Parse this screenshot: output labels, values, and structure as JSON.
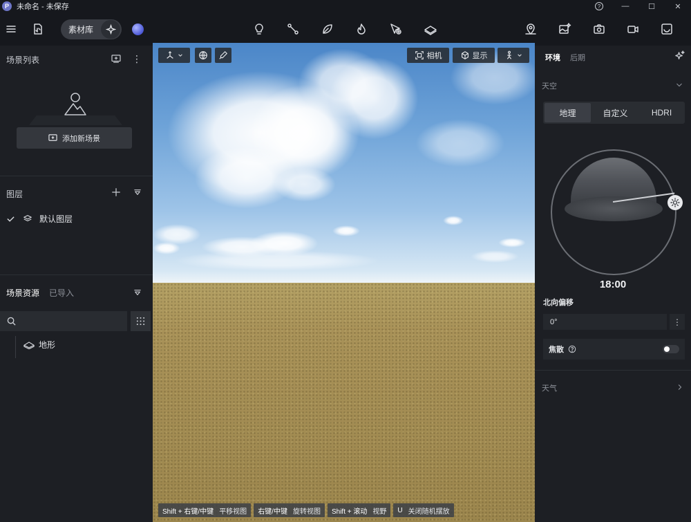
{
  "window": {
    "title": "未命名 - 未保存",
    "logo_letter": "P",
    "help": "?",
    "minimize": "—",
    "maximize": "☐",
    "close": "✕"
  },
  "toolbar": {
    "library_label": "素材库"
  },
  "left_panel": {
    "scene_list_title": "场景列表",
    "add_scene_label": "添加新场景",
    "layers_title": "图层",
    "default_layer": "默认图层",
    "resources_tab": "场景资源",
    "imported_tab": "已导入",
    "search_placeholder": "",
    "terrain_label": "地形"
  },
  "viewport": {
    "camera_label": "相机",
    "display_label": "显示",
    "hints": [
      {
        "key": "Shift + 右键/中键",
        "action": "平移视图"
      },
      {
        "key": "右键/中键",
        "action": "旋转视图"
      },
      {
        "key": "Shift + 滚动",
        "action": "视野"
      },
      {
        "key": "U",
        "action": "关闭随机摆放"
      }
    ]
  },
  "right_panel": {
    "tab_environment": "环境",
    "tab_post": "后期",
    "sky_header": "天空",
    "sky_modes": [
      "地理",
      "自定义",
      "HDRI"
    ],
    "active_sky_mode": "地理",
    "time": "18:00",
    "north_offset_label": "北向偏移",
    "north_offset_value": "0°",
    "more": "⋮",
    "caustics_label": "焦散",
    "caustics_enabled": false,
    "weather_header": "天气"
  },
  "colors": {
    "panel_bg": "#1d1f24",
    "app_bg": "#16181d",
    "active_tab": "#ffffff",
    "muted_text": "#8c9098"
  }
}
